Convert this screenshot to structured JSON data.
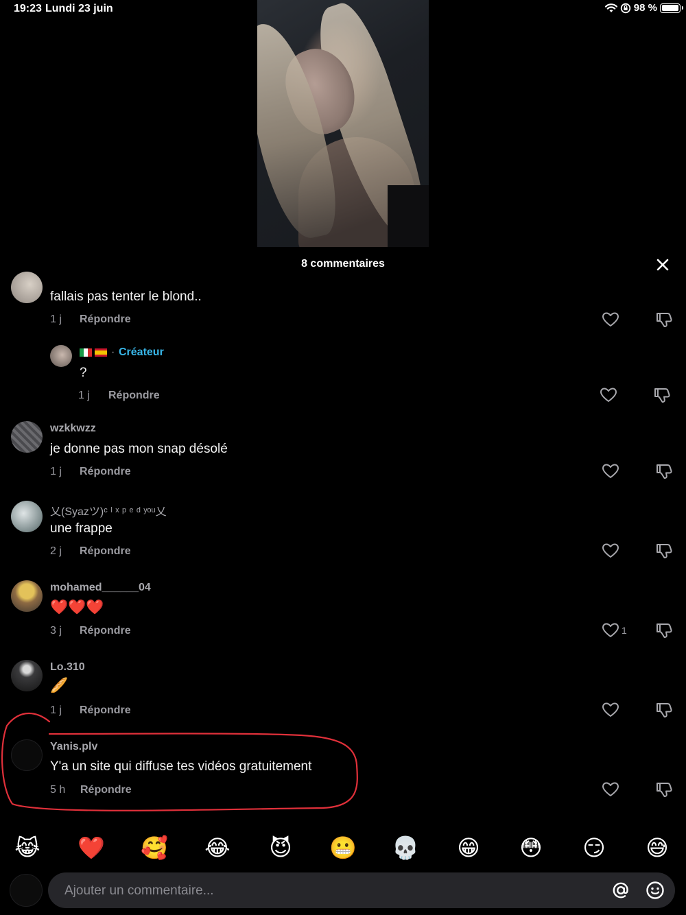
{
  "status_bar": {
    "time": "19:23",
    "date": "Lundi 23 juin",
    "battery": "98 %"
  },
  "comments_panel": {
    "title": "8 commentaires"
  },
  "comments": [
    {
      "username": "",
      "text": "fallais pas tenter le blond..",
      "age": "1 j",
      "reply": "Répondre"
    },
    {
      "username": "",
      "creator_label": "Créateur",
      "separator": "·",
      "text": "?",
      "age": "1 j",
      "reply": "Répondre",
      "flags": [
        "Italy",
        "Spain"
      ]
    },
    {
      "username": "wzkkwzz",
      "text": "je donne pas mon snap désolé",
      "age": "1 j",
      "reply": "Répondre"
    },
    {
      "username": "乂(Syazツ)ᶜ ˡ ˣ ᵖ ᵉ ᵈ ʸᵒᵘ乂",
      "text": "une frappe",
      "age": "2 j",
      "reply": "Répondre"
    },
    {
      "username": "mohamed______04",
      "text": "❤️❤️❤️",
      "age": "3 j",
      "reply": "Répondre",
      "likes": "1"
    },
    {
      "username": "Lo.310",
      "text": "🥖",
      "age": "1 j",
      "reply": "Répondre"
    },
    {
      "username": "Yanis.plv",
      "text": "Y'a un site qui diffuse tes vidéos gratuitement",
      "age": "5 h",
      "reply": "Répondre"
    }
  ],
  "emoji_bar": [
    "😹",
    "❤️",
    "🥰",
    "😂",
    "😈",
    "😬",
    "💀",
    "😁",
    "😳",
    "😏",
    "😅"
  ],
  "input": {
    "placeholder": "Ajouter un commentaire..."
  },
  "colors": {
    "background": "#000000",
    "creator": "#38b6e8",
    "highlight": "#e0303a",
    "input_bg": "#26262a"
  }
}
